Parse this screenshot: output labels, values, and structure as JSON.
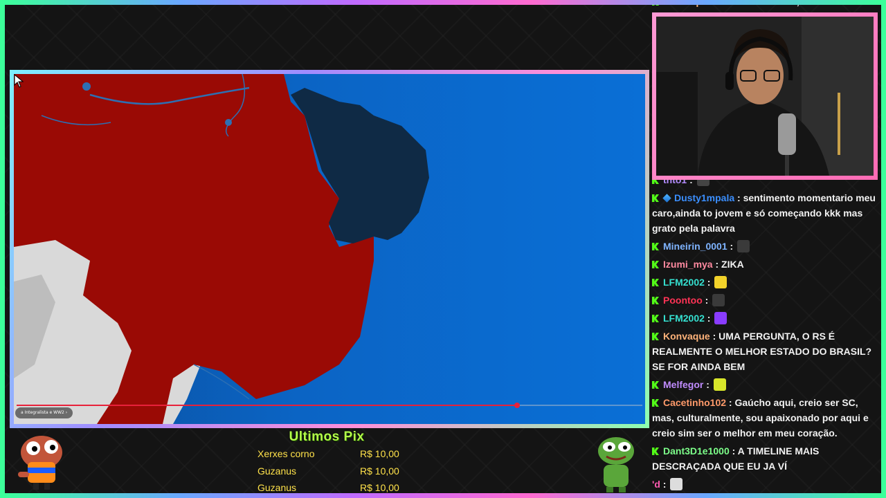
{
  "video": {
    "caption": "a Integralista e WW2 ›",
    "progress": 0.8
  },
  "chat_top": {
    "user": "Konvaque",
    "text": "UMA PERGUNTA, O RS É"
  },
  "chat": [
    {
      "user": "thto1",
      "color": "#b38cff",
      "text": "",
      "emote": "#444444",
      "badge": false
    },
    {
      "user": "Dusty1mpala",
      "color": "#3b8fff",
      "text": "sentimento momentario meu caro,ainda to jovem e só começando kkk mas grato pela palavra",
      "emote": "",
      "badge": true
    },
    {
      "user": "Mineirin_0001",
      "color": "#7fb4ff",
      "text": "",
      "emote": "#3a3a3a",
      "badge": false
    },
    {
      "user": "Izumi_mya",
      "color": "#ff8aa0",
      "text": "ZIKA",
      "emote": "",
      "badge": false
    },
    {
      "user": "LFM2002",
      "color": "#35e0d0",
      "text": "",
      "emote": "#f2d22a",
      "badge": false
    },
    {
      "user": "Poontoo",
      "color": "#ff3355",
      "text": "",
      "emote": "#3a3a3a",
      "badge": false
    },
    {
      "user": "LFM2002",
      "color": "#35e0d0",
      "text": "",
      "emote": "#8a3cff",
      "badge": false
    },
    {
      "user": "Konvaque",
      "color": "#ffb37a",
      "text": "UMA PERGUNTA, O RS É REALMENTE O MELHOR ESTADO DO BRASIL? SE FOR AINDA BEM",
      "emote": "",
      "badge": false
    },
    {
      "user": "Melfegor",
      "color": "#c08cff",
      "text": "",
      "emote": "#d8e62a",
      "badge": false
    },
    {
      "user": "Cacetinho102",
      "color": "#ff9a6a",
      "text": "Gaúcho aqui, creio ser SC, mas, culturalmente, sou apaixonado por aqui e creio sim ser o melhor em meu coração.",
      "emote": "",
      "badge": false
    },
    {
      "user": "Dant3D1e1000",
      "color": "#7dff8a",
      "text": "A TIMELINE MAIS DESCRAÇADA QUE EU JA VÍ",
      "emote": "",
      "badge": false
    },
    {
      "user": "'d",
      "color": "#ff5ab0",
      "text": "",
      "emote": "#dddddd",
      "badge": false,
      "nokick": true
    }
  ],
  "pix": {
    "title": "Ultimos Pix",
    "rows": [
      {
        "name": "Xerxes corno",
        "amount": "R$ 10,00"
      },
      {
        "name": "Guzanus",
        "amount": "R$ 10,00"
      },
      {
        "name": "Guzanus",
        "amount": "R$ 10,00"
      }
    ]
  },
  "colors": {
    "territory_red": "#9a0a05",
    "territory_dark": "#0f2a45",
    "ocean": "#0b64c4",
    "pix_title": "#b4ff4a",
    "pix_rows": "#ffe24a"
  }
}
